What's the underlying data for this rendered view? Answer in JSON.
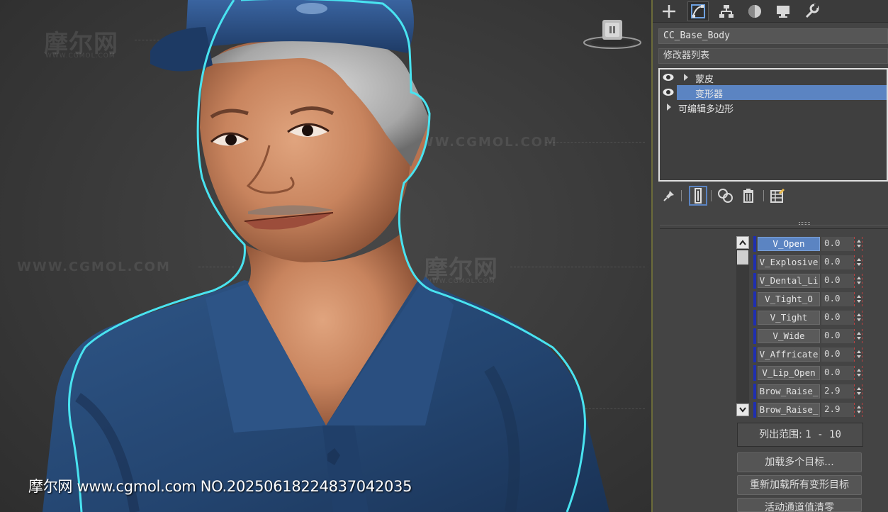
{
  "watermark": {
    "logo_text": "摩尔网",
    "logo_sub": "WWW.CGMOL.COM",
    "url_text": "WWW.CGMOL.COM"
  },
  "caption": "摩尔网 www.cgmol.com NO.20250618224837042035",
  "tabs": [
    {
      "icon": "plus-icon",
      "active": false
    },
    {
      "icon": "modify-curve-icon",
      "active": true
    },
    {
      "icon": "hierarchy-icon",
      "active": false
    },
    {
      "icon": "motion-sphere-icon",
      "active": false
    },
    {
      "icon": "display-monitor-icon",
      "active": false
    },
    {
      "icon": "wrench-icon",
      "active": false
    }
  ],
  "object_name": "CC_Base_Body",
  "modifier_list_label": "修改器列表",
  "modifier_stack": [
    {
      "label": "蒙皮",
      "visible": true,
      "expandable": true,
      "selected": false
    },
    {
      "label": "变形器",
      "visible": true,
      "expandable": false,
      "selected": true
    },
    {
      "label": "可编辑多边形",
      "visible": false,
      "expandable": true,
      "selected": false
    }
  ],
  "stack_toolbar": [
    "pin-stack-icon",
    "show-end-result-icon",
    "make-unique-icon",
    "remove-modifier-icon",
    "configure-modifier-sets-icon"
  ],
  "channels": [
    {
      "name": "V_Open",
      "value": "0.0",
      "active": true
    },
    {
      "name": "V_Explosive",
      "value": "0.0",
      "active": false
    },
    {
      "name": "V_Dental_Li",
      "value": "0.0",
      "active": false
    },
    {
      "name": "V_Tight_O",
      "value": "0.0",
      "active": false
    },
    {
      "name": "V_Tight",
      "value": "0.0",
      "active": false
    },
    {
      "name": "V_Wide",
      "value": "0.0",
      "active": false
    },
    {
      "name": "V_Affricate",
      "value": "0.0",
      "active": false
    },
    {
      "name": "V_Lip_Open",
      "value": "0.0",
      "active": false
    },
    {
      "name": "Brow_Raise_",
      "value": "2.9",
      "active": false
    },
    {
      "name": "Brow_Raise_",
      "value": "2.9",
      "active": false
    }
  ],
  "list_range": {
    "label": "列出范围:",
    "value": "1 - 10"
  },
  "buttons": {
    "load_multiple": "加载多个目标...",
    "reload_all": "重新加载所有变形目标",
    "zero_active": "活动通道值清零"
  }
}
